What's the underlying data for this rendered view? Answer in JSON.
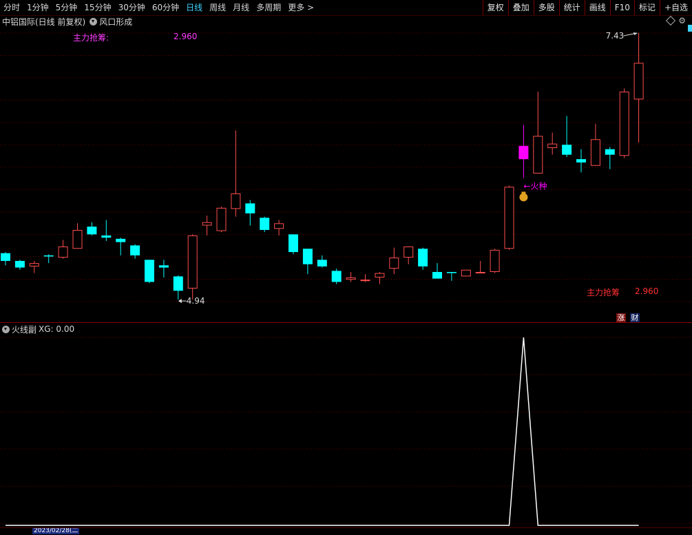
{
  "toolbar": {
    "periods": [
      "分时",
      "1分钟",
      "5分钟",
      "15分钟",
      "30分钟",
      "60分钟",
      "日线",
      "周线",
      "月线",
      "多周期",
      "更多 >"
    ],
    "active_period": "日线",
    "buttons": [
      "复权",
      "叠加",
      "多股",
      "统计",
      "画线",
      "F10",
      "标记",
      "+自选"
    ]
  },
  "title": {
    "stock": "中铝国际(日线 前复权)",
    "formula": "风口形成"
  },
  "main_panel": {
    "legend_label": "主力抢筹:",
    "legend_value": "2.960",
    "high_label": "7.43",
    "low_label": "4.94",
    "signal_label": "←火种",
    "bottom_label": "主力抢筹",
    "bottom_value": "2.960",
    "badge_up": "涨",
    "badge_fin": "财"
  },
  "sub_panel": {
    "title": "火线副",
    "indicator": "XG: 0.00"
  },
  "bottom": {
    "date": "2023/02/28(二"
  },
  "colors": {
    "up": "#ff4e4e",
    "down": "#00ffff",
    "signal": "#ff00ff",
    "grid": "#6a0000",
    "toolbar_active": "#3fd4ff"
  },
  "chart_data": {
    "type": "candlestick",
    "ylim": [
      4.94,
      7.43
    ],
    "candles": [
      {
        "o": 5.44,
        "c": 5.37,
        "h": 5.45,
        "l": 5.33
      },
      {
        "o": 5.37,
        "c": 5.31,
        "h": 5.38,
        "l": 5.29
      },
      {
        "o": 5.32,
        "c": 5.35,
        "h": 5.37,
        "l": 5.26
      },
      {
        "o": 5.42,
        "c": 5.41,
        "h": 5.43,
        "l": 5.35
      },
      {
        "o": 5.4,
        "c": 5.5,
        "h": 5.56,
        "l": 5.39
      },
      {
        "o": 5.48,
        "c": 5.65,
        "h": 5.71,
        "l": 5.48
      },
      {
        "o": 5.68,
        "c": 5.61,
        "h": 5.72,
        "l": 5.6
      },
      {
        "o": 5.6,
        "c": 5.58,
        "h": 5.74,
        "l": 5.55
      },
      {
        "o": 5.57,
        "c": 5.54,
        "h": 5.58,
        "l": 5.42
      },
      {
        "o": 5.51,
        "c": 5.42,
        "h": 5.52,
        "l": 5.39
      },
      {
        "o": 5.38,
        "c": 5.18,
        "h": 5.38,
        "l": 5.17
      },
      {
        "o": 5.33,
        "c": 5.31,
        "h": 5.38,
        "l": 5.22
      },
      {
        "o": 5.23,
        "c": 5.1,
        "h": 5.24,
        "l": 5.02
      },
      {
        "o": 5.12,
        "c": 5.6,
        "h": 5.61,
        "l": 5.02
      },
      {
        "o": 5.69,
        "c": 5.72,
        "h": 5.78,
        "l": 5.6
      },
      {
        "o": 5.64,
        "c": 5.85,
        "h": 5.86,
        "l": 5.63
      },
      {
        "o": 5.84,
        "c": 5.98,
        "h": 6.55,
        "l": 5.77
      },
      {
        "o": 5.89,
        "c": 5.8,
        "h": 5.92,
        "l": 5.69
      },
      {
        "o": 5.76,
        "c": 5.65,
        "h": 5.77,
        "l": 5.63
      },
      {
        "o": 5.66,
        "c": 5.71,
        "h": 5.74,
        "l": 5.6
      },
      {
        "o": 5.61,
        "c": 5.45,
        "h": 5.61,
        "l": 5.43
      },
      {
        "o": 5.48,
        "c": 5.34,
        "h": 5.48,
        "l": 5.25
      },
      {
        "o": 5.38,
        "c": 5.32,
        "h": 5.42,
        "l": 5.31
      },
      {
        "o": 5.28,
        "c": 5.18,
        "h": 5.3,
        "l": 5.16
      },
      {
        "o": 5.2,
        "c": 5.22,
        "h": 5.27,
        "l": 5.18
      },
      {
        "o": 5.2,
        "c": 5.2,
        "h": 5.25,
        "l": 5.18
      },
      {
        "o": 5.22,
        "c": 5.26,
        "h": 5.27,
        "l": 5.16
      },
      {
        "o": 5.3,
        "c": 5.4,
        "h": 5.49,
        "l": 5.25
      },
      {
        "o": 5.4,
        "c": 5.5,
        "h": 5.5,
        "l": 5.34
      },
      {
        "o": 5.48,
        "c": 5.32,
        "h": 5.49,
        "l": 5.29
      },
      {
        "o": 5.27,
        "c": 5.21,
        "h": 5.35,
        "l": 5.21
      },
      {
        "o": 5.27,
        "c": 5.26,
        "h": 5.27,
        "l": 5.19
      },
      {
        "o": 5.23,
        "c": 5.29,
        "h": 5.29,
        "l": 5.23
      },
      {
        "o": 5.27,
        "c": 5.27,
        "h": 5.37,
        "l": 5.26
      },
      {
        "o": 5.27,
        "c": 5.47,
        "h": 5.48,
        "l": 5.26
      },
      {
        "o": 5.48,
        "c": 6.04,
        "h": 6.05,
        "l": 5.47
      },
      {
        "o": 6.41,
        "c": 6.29,
        "h": 6.6,
        "l": 6.12,
        "signal": true
      },
      {
        "o": 6.16,
        "c": 6.5,
        "h": 6.9,
        "l": 6.16
      },
      {
        "o": 6.39,
        "c": 6.43,
        "h": 6.53,
        "l": 6.33
      },
      {
        "o": 6.42,
        "c": 6.33,
        "h": 6.68,
        "l": 6.31
      },
      {
        "o": 6.29,
        "c": 6.26,
        "h": 6.38,
        "l": 6.17
      },
      {
        "o": 6.23,
        "c": 6.47,
        "h": 6.61,
        "l": 6.23
      },
      {
        "o": 6.38,
        "c": 6.33,
        "h": 6.4,
        "l": 6.2
      },
      {
        "o": 6.32,
        "c": 6.9,
        "h": 6.93,
        "l": 6.3
      },
      {
        "o": 6.83,
        "c": 7.16,
        "h": 7.43,
        "l": 6.44
      }
    ],
    "sub_series": {
      "name": "XG",
      "values": [
        0,
        0,
        0,
        0,
        0,
        0,
        0,
        0,
        0,
        0,
        0,
        0,
        0,
        0,
        0,
        0,
        0,
        0,
        0,
        0,
        0,
        0,
        0,
        0,
        0,
        0,
        0,
        0,
        0,
        0,
        0,
        0,
        0,
        0,
        0,
        0,
        1,
        0,
        0,
        0,
        0,
        0,
        0,
        0,
        0
      ],
      "ylim": [
        0,
        1
      ]
    }
  }
}
